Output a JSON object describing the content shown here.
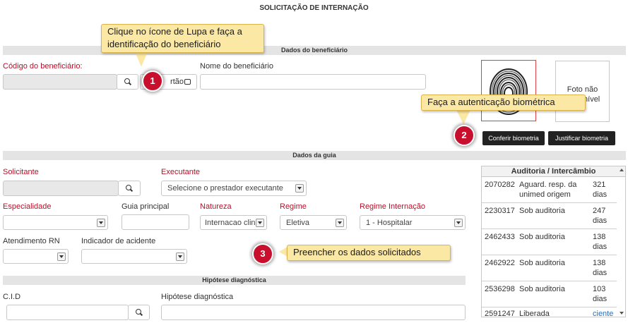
{
  "page_title": "SOLICITAÇÃO DE INTERNAÇÃO",
  "sections": {
    "beneficiario": "Dados do beneficiário",
    "guia": "Dados da guia",
    "hipotese": "Hipótese diagnóstica"
  },
  "beneficiario": {
    "codigo_label": "Código do beneficiário:",
    "codigo_value": "",
    "cartao_label": "rtão",
    "nome_label": "Nome do beneficiário",
    "nome_value": "",
    "foto_text": "Foto não disponível",
    "conferir_label": "Conferir biometria",
    "justificar_label": "Justificar biometria"
  },
  "guia": {
    "solicitante_label": "Solicitante",
    "solicitante_value": "",
    "executante_label": "Executante",
    "executante_value": "Selecione o prestador executante",
    "especialidade_label": "Especialidade",
    "especialidade_value": "",
    "guia_principal_label": "Guia principal",
    "guia_principal_value": "",
    "natureza_label": "Natureza",
    "natureza_value": "Internacao clin",
    "regime_label": "Regime",
    "regime_value": "Eletiva",
    "regime_internacao_label": "Regime Internação",
    "regime_internacao_value": "1 - Hospitalar",
    "atendimento_rn_label": "Atendimento RN",
    "atendimento_rn_value": "",
    "indicador_acidente_label": "Indicador de acidente",
    "indicador_acidente_value": ""
  },
  "hipotese": {
    "cid_label": "C.I.D",
    "cid_value": "",
    "hipotese_label": "Hipótese diagnóstica",
    "hipotese_value": ""
  },
  "auditoria": {
    "title": "Auditoria / Intercâmbio",
    "rows": [
      {
        "id": "2070282",
        "status": "Aguard. resp. da unimed origem",
        "dias": "321 dias"
      },
      {
        "id": "2230317",
        "status": "Sob auditoria",
        "dias": "247 dias"
      },
      {
        "id": "2462433",
        "status": "Sob auditoria",
        "dias": "138 dias"
      },
      {
        "id": "2462922",
        "status": "Sob auditoria",
        "dias": "138 dias"
      },
      {
        "id": "2536298",
        "status": "Sob auditoria",
        "dias": "103 dias"
      },
      {
        "id": "2591247",
        "status": "Liberada",
        "dias": "ciente"
      }
    ]
  },
  "callouts": {
    "c1": "Clique no ícone de Lupa e faça a identificação do beneficiário",
    "c2": "Faça a autenticação biométrica",
    "c3": "Preencher os dados solicitados"
  },
  "badges": {
    "b1": "1",
    "b2": "2",
    "b3": "3"
  },
  "icons": {
    "search": "search-icon",
    "fingerprint": "fingerprint-icon",
    "card": "card-icon"
  },
  "colors": {
    "required_label": "#b3122a",
    "badge": "#c8102e",
    "callout_bg": "#fbe8a5",
    "dark_button": "#222222",
    "link": "#2a6ebb"
  }
}
